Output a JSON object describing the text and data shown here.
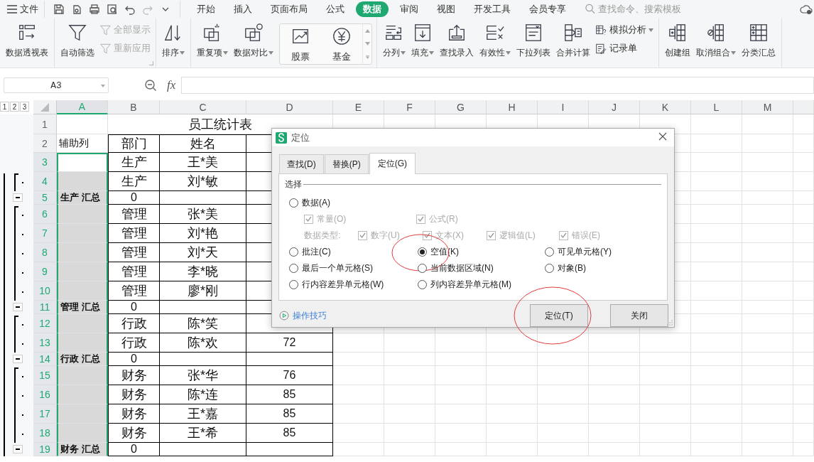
{
  "menu_bar": {
    "file_menu": "文件",
    "quick_access": [
      {
        "disabled": false
      },
      {
        "disabled": false
      },
      {
        "disabled": false
      },
      {
        "disabled": false
      },
      {
        "disabled": false
      },
      {
        "disabled": true
      }
    ],
    "tabs": [
      {
        "label": "开始",
        "selected": false
      },
      {
        "label": "插入",
        "selected": false
      },
      {
        "label": "页面布局",
        "selected": false
      },
      {
        "label": "公式",
        "selected": false
      },
      {
        "label": "数据",
        "selected": true
      },
      {
        "label": "审阅",
        "selected": false
      },
      {
        "label": "视图",
        "selected": false
      },
      {
        "label": "开发工具",
        "selected": false
      },
      {
        "label": "会员专享",
        "selected": false
      }
    ],
    "search": {
      "placeholder": "查找命令、搜索模板"
    }
  },
  "ribbon": {
    "groups": [
      {
        "items": [
          {
            "kind": "large",
            "label": "数据透视表",
            "dropdown": false
          }
        ]
      },
      {
        "launcher": true,
        "items": [
          {
            "kind": "large",
            "label": "自动筛选",
            "dropdown": false
          },
          {
            "kind": "stack",
            "items": [
              {
                "label": "全部显示",
                "disabled": true,
                "dropdown": false
              },
              {
                "label": "重新应用",
                "disabled": true,
                "dropdown": false
              }
            ]
          }
        ]
      },
      {
        "items": [
          {
            "kind": "large",
            "label": "排序",
            "dropdown": true
          }
        ]
      },
      {
        "items": [
          {
            "kind": "large",
            "label": "重复项",
            "dropdown": true
          },
          {
            "kind": "large",
            "label": "数据对比",
            "dropdown": true
          },
          {
            "kind": "gallery",
            "items": [
              {
                "label": "股票"
              },
              {
                "label": "基金"
              }
            ]
          }
        ]
      },
      {
        "items": [
          {
            "kind": "large",
            "label": "分列",
            "dropdown": true
          },
          {
            "kind": "large",
            "label": "填充",
            "dropdown": true
          },
          {
            "kind": "large",
            "label": "查找录入",
            "dropdown": false
          },
          {
            "kind": "large",
            "label": "有效性",
            "dropdown": true
          },
          {
            "kind": "large",
            "label": "下拉列表",
            "dropdown": false
          },
          {
            "kind": "large",
            "label": "合并计算",
            "dropdown": false
          },
          {
            "kind": "stack",
            "items": [
              {
                "label": "模拟分析",
                "disabled": false,
                "dropdown": true
              },
              {
                "label": "记录单",
                "disabled": false,
                "dropdown": false
              }
            ]
          }
        ]
      },
      {
        "items": [
          {
            "kind": "large",
            "label": "创建组",
            "dropdown": false
          },
          {
            "kind": "large",
            "label": "取消组合",
            "dropdown": true
          },
          {
            "kind": "large",
            "label": "分类汇总",
            "dropdown": false
          }
        ]
      }
    ]
  },
  "formula_bar": {
    "name_box": "A3",
    "function_label": "fx"
  },
  "sheet": {
    "outline_levels": [
      "1",
      "2",
      "3"
    ],
    "columns": [
      {
        "letter": "A",
        "selected": true
      },
      {
        "letter": "B",
        "selected": false
      },
      {
        "letter": "C",
        "selected": false
      },
      {
        "letter": "D",
        "selected": false
      },
      {
        "letter": "E",
        "selected": false
      },
      {
        "letter": "F",
        "selected": false
      },
      {
        "letter": "G",
        "selected": false
      },
      {
        "letter": "H",
        "selected": false
      },
      {
        "letter": "I",
        "selected": false
      },
      {
        "letter": "J",
        "selected": false
      },
      {
        "letter": "K",
        "selected": false
      },
      {
        "letter": "L",
        "selected": false
      },
      {
        "letter": "M",
        "selected": false
      }
    ],
    "rows": [
      {
        "number": "1",
        "kind": "title",
        "selected": false,
        "title": "员工统计表"
      },
      {
        "number": "2",
        "kind": "header",
        "selected": false,
        "a": "辅助列",
        "b": "部门",
        "c": "姓名"
      },
      {
        "number": "3",
        "kind": "detail",
        "selected": true,
        "active": true,
        "b": "生产",
        "c": "王*美"
      },
      {
        "number": "4",
        "kind": "detail",
        "selected": true,
        "grouped": true,
        "b": "生产",
        "c": "刘*敏"
      },
      {
        "number": "5",
        "kind": "subtotal",
        "selected": true,
        "collapsible": true,
        "a": "生产  汇总",
        "b": "0"
      },
      {
        "number": "6",
        "kind": "detail",
        "selected": true,
        "grouped": true,
        "b": "管理",
        "c": "张*美"
      },
      {
        "number": "7",
        "kind": "detail",
        "selected": true,
        "grouped": true,
        "b": "管理",
        "c": "刘*艳"
      },
      {
        "number": "8",
        "kind": "detail",
        "selected": true,
        "grouped": true,
        "b": "管理",
        "c": "刘*天"
      },
      {
        "number": "9",
        "kind": "detail",
        "selected": true,
        "grouped": true,
        "b": "管理",
        "c": "李*晓"
      },
      {
        "number": "10",
        "kind": "detail",
        "selected": true,
        "grouped": true,
        "b": "管理",
        "c": "廖*刚"
      },
      {
        "number": "11",
        "kind": "subtotal",
        "selected": true,
        "collapsible": true,
        "a": "管理  汇总",
        "b": "0"
      },
      {
        "number": "12",
        "kind": "detail",
        "selected": true,
        "grouped": true,
        "b": "行政",
        "c": "陈*笑"
      },
      {
        "number": "13",
        "kind": "detail",
        "selected": true,
        "grouped": true,
        "b": "行政",
        "c": "陈*欢",
        "d": "72"
      },
      {
        "number": "14",
        "kind": "subtotal",
        "selected": true,
        "collapsible": true,
        "a": "行政  汇总",
        "b": "0"
      },
      {
        "number": "15",
        "kind": "detail",
        "selected": true,
        "grouped": true,
        "b": "财务",
        "c": "张*华",
        "d": "76"
      },
      {
        "number": "16",
        "kind": "detail",
        "selected": true,
        "grouped": true,
        "b": "财务",
        "c": "陈*连",
        "d": "85"
      },
      {
        "number": "17",
        "kind": "detail",
        "selected": true,
        "grouped": true,
        "b": "财务",
        "c": "王*嘉",
        "d": "85"
      },
      {
        "number": "18",
        "kind": "detail",
        "selected": true,
        "grouped": true,
        "b": "财务",
        "c": "王*希",
        "d": "85"
      },
      {
        "number": "19",
        "kind": "subtotal",
        "selected": true,
        "collapsible": true,
        "a": "财务  汇总",
        "b": "0"
      }
    ]
  },
  "dialog": {
    "title": "定位",
    "tabs": [
      {
        "label": "查找(D)",
        "selected": false
      },
      {
        "label": "替换(P)",
        "selected": false
      },
      {
        "label": "定位(G)",
        "selected": true
      }
    ],
    "group_label": "选择",
    "data_option": {
      "label": "数据(A)",
      "selected": false,
      "circled": false
    },
    "data_checks": [
      {
        "label": "常量(O)",
        "checked": true,
        "disabled": true
      },
      {
        "label": "公式(R)",
        "checked": true,
        "disabled": true
      }
    ],
    "type_label": "数据类型:",
    "type_checks": [
      {
        "label": "数字(U)",
        "checked": true,
        "disabled": true
      },
      {
        "label": "文本(X)",
        "checked": true,
        "disabled": true
      },
      {
        "label": "逻辑值(L)",
        "checked": true,
        "disabled": true
      },
      {
        "label": "错误(E)",
        "checked": true,
        "disabled": true
      }
    ],
    "options": [
      {
        "label": "批注(C)",
        "selected": false,
        "circled": false
      },
      {
        "label": "空值(K)",
        "selected": true,
        "circled": true
      },
      {
        "label": "可见单元格(Y)",
        "selected": false,
        "circled": false
      },
      {
        "label": "最后一个单元格(S)",
        "selected": false,
        "circled": false
      },
      {
        "label": "当前数据区域(N)",
        "selected": false,
        "circled": false
      },
      {
        "label": "对象(B)",
        "selected": false,
        "circled": false
      },
      {
        "label": "行内容差异单元格(W)",
        "selected": false,
        "circled": false
      },
      {
        "label": "列内容差异单元格(M)",
        "selected": false,
        "circled": false
      }
    ],
    "help_link": "操作技巧",
    "buttons": [
      {
        "label": "定位(T)",
        "circled": true
      },
      {
        "label": "关闭",
        "circled": false
      }
    ]
  }
}
